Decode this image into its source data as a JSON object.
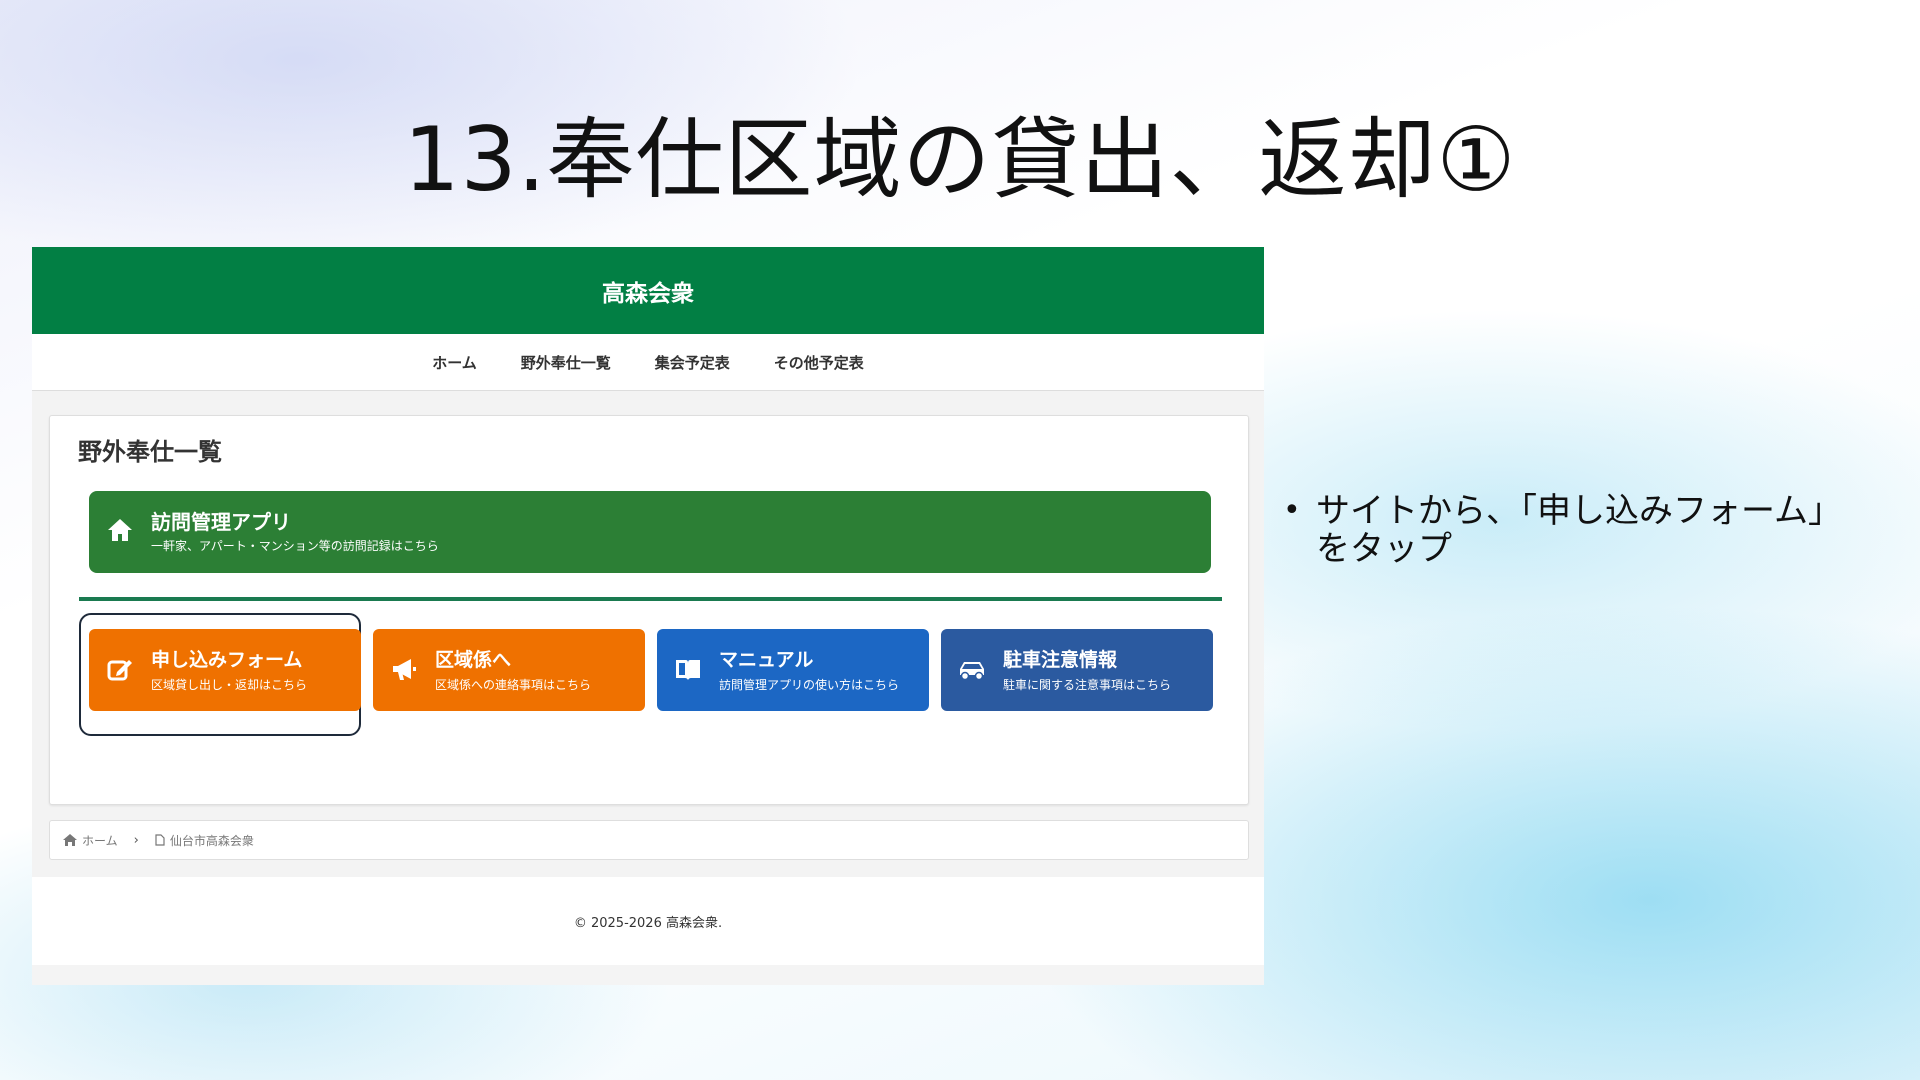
{
  "slide": {
    "title": "13.奉仕区域の貸出、返却①",
    "bullets": [
      "サイトから、「申し込みフォーム」をタップ"
    ]
  },
  "site": {
    "name": "高森会衆",
    "nav": [
      "ホーム",
      "野外奉仕一覧",
      "集会予定表",
      "その他予定表"
    ],
    "section_title": "野外奉仕一覧",
    "app_banner": {
      "title": "訪問管理アプリ",
      "subtitle": "一軒家、アパート・マンション等の訪問記録はこちら",
      "icon": "home-icon",
      "color": "#2c7f35"
    },
    "tiles": [
      {
        "title": "申し込みフォーム",
        "subtitle": "区域貸し出し・返却はこちら",
        "icon": "edit-icon",
        "color": "#ef7100",
        "highlighted": true
      },
      {
        "title": "区域係へ",
        "subtitle": "区域係への連絡事項はこちら",
        "icon": "megaphone-icon",
        "color": "#ef7100"
      },
      {
        "title": "マニュアル",
        "subtitle": "訪問管理アプリの使い方はこちら",
        "icon": "book-icon",
        "color": "#1c67c4"
      },
      {
        "title": "駐車注意情報",
        "subtitle": "駐車に関する注意事項はこちら",
        "icon": "car-icon",
        "color": "#2b5aa0"
      }
    ],
    "breadcrumb": [
      "ホーム",
      "仙台市高森会衆"
    ],
    "footer": "© 2025-2026 高森会衆.",
    "header_color": "#027f44"
  }
}
